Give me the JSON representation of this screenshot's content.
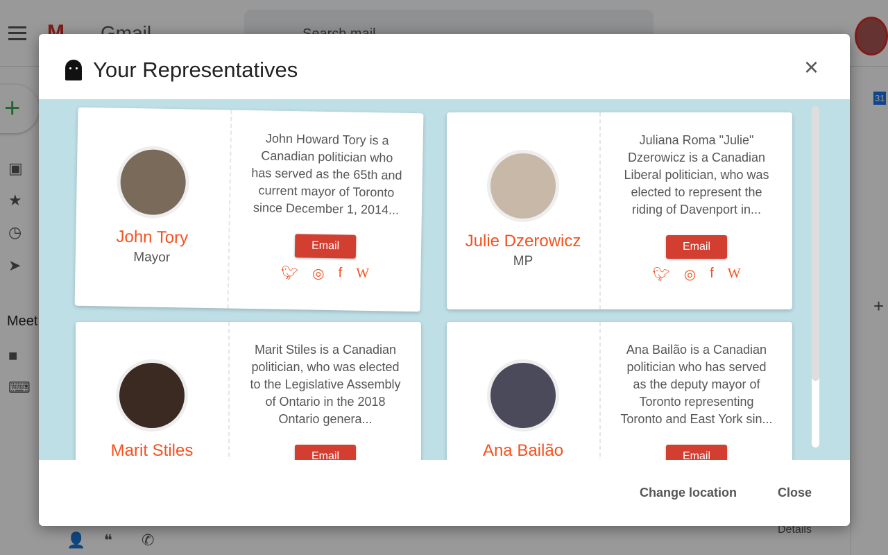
{
  "gmail": {
    "logo_text": "Gmail",
    "search_placeholder": "Search mail",
    "meet_label": "Meet",
    "details_label": "Details",
    "calendar_badge": "31"
  },
  "dialog": {
    "title": "Your Representatives",
    "close_icon": "×",
    "change_location": "Change location",
    "close": "Close"
  },
  "representatives": [
    {
      "name": "John Tory",
      "role": "Mayor",
      "description": "John Howard Tory is a Canadian politician who has served as the 65th and current mayor of Toronto since December 1, 2014...",
      "email_label": "Email",
      "photo_color": "#7a6a5a"
    },
    {
      "name": "Julie Dzerowicz",
      "role": "MP",
      "description": "Juliana Roma \"Julie\" Dzerowicz is a Canadian Liberal politician, who was elected to represent the riding of Davenport in...",
      "email_label": "Email",
      "photo_color": "#c8b8a8"
    },
    {
      "name": "Marit Stiles",
      "role": "",
      "description": "Marit Stiles is a Canadian politician, who was elected to the Legislative Assembly of Ontario in the 2018 Ontario genera...",
      "email_label": "Email",
      "photo_color": "#3a2a22"
    },
    {
      "name": "Ana Bailão",
      "role": "",
      "description": "Ana Bailão is a Canadian politician who has served as the deputy mayor of Toronto representing Toronto and East York sin...",
      "email_label": "Email",
      "photo_color": "#4a4a5a"
    }
  ],
  "social_icons": [
    "twitter-icon",
    "instagram-icon",
    "facebook-icon",
    "wikipedia-icon"
  ],
  "scroll_position": 0.0,
  "colors": {
    "accent": "#f4511e",
    "email_button": "#d23f31",
    "body_bg": "#bedfe6"
  }
}
